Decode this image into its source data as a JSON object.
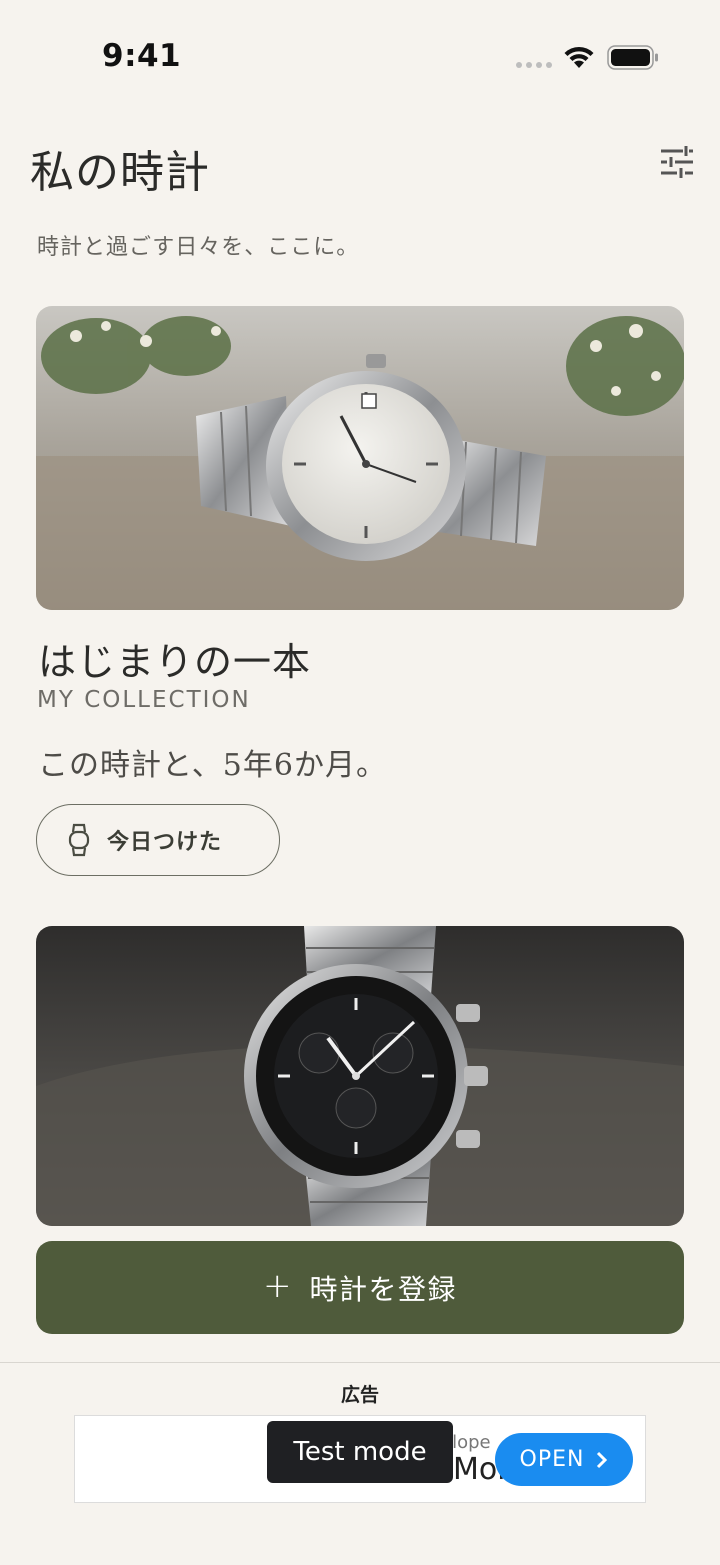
{
  "status_bar": {
    "time": "9:41"
  },
  "header": {
    "title": "私の時計",
    "subtitle": "時計と過ごす日々を、ここに。",
    "filter_icon": "sliders-icon"
  },
  "watches": [
    {
      "name": "はじまりの一本",
      "collection": "MY COLLECTION",
      "duration": "この時計と、5年6か月。",
      "action_label": "今日つけた",
      "action_icon": "watch-icon"
    }
  ],
  "register_button": {
    "label": "時計を登録",
    "icon": "plus-icon"
  },
  "ad": {
    "label": "広告",
    "developer": "elope",
    "app_name": "Mobile",
    "open_label": "OPEN",
    "test_mode": "Test mode"
  },
  "colors": {
    "background": "#f6f3ee",
    "accent_green": "#4f5b3b",
    "ad_blue": "#1a8cf0"
  }
}
